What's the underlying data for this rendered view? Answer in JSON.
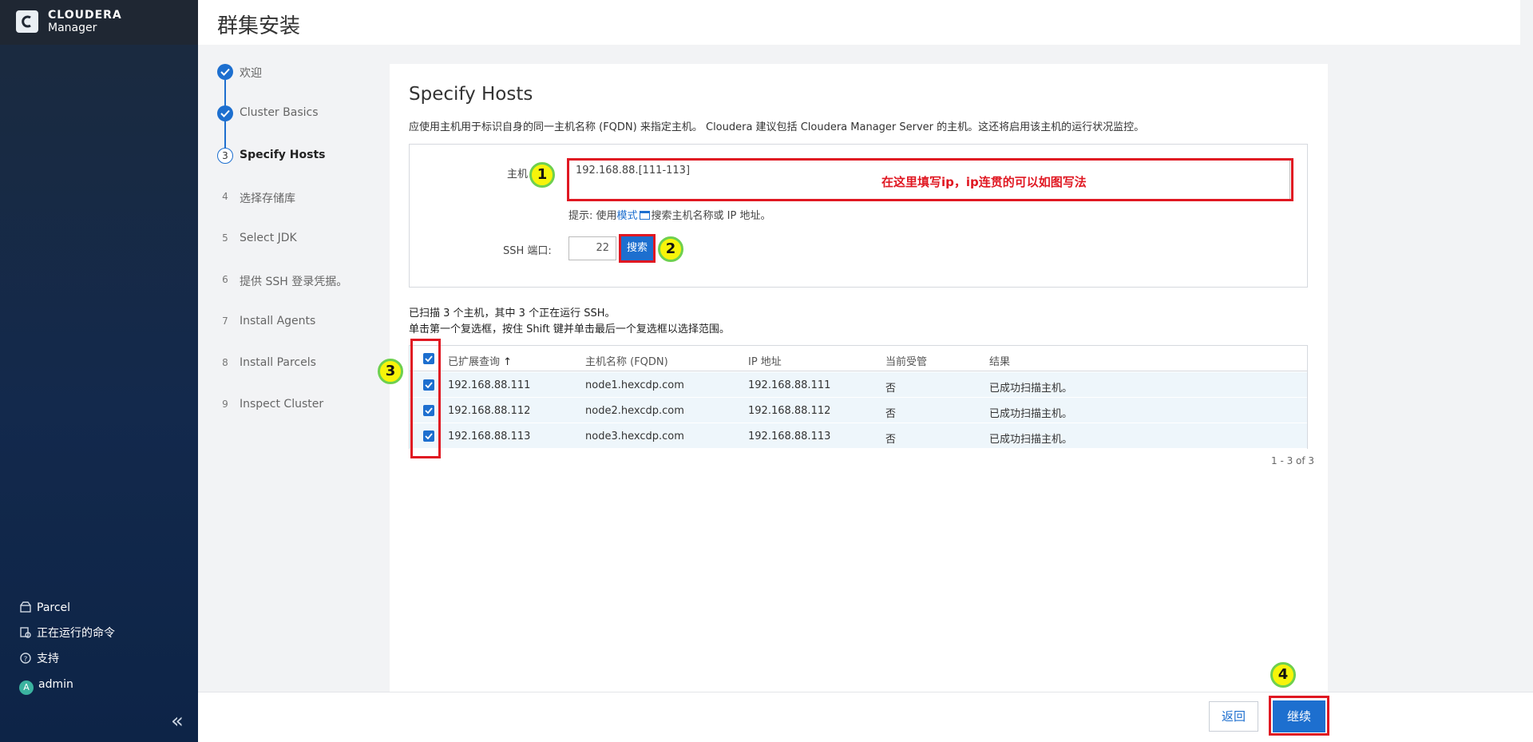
{
  "brand": {
    "line1": "CLOUDERA",
    "line2": "Manager"
  },
  "page_title": "群集安装",
  "steps": [
    {
      "num": "✓",
      "label": "欢迎",
      "state": "done"
    },
    {
      "num": "✓",
      "label": "Cluster Basics",
      "state": "done"
    },
    {
      "num": "3",
      "label": "Specify Hosts",
      "state": "current"
    },
    {
      "num": "4",
      "label": "选择存储库",
      "state": "todo"
    },
    {
      "num": "5",
      "label": "Select JDK",
      "state": "todo"
    },
    {
      "num": "6",
      "label": "提供 SSH 登录凭据。",
      "state": "todo"
    },
    {
      "num": "7",
      "label": "Install Agents",
      "state": "todo"
    },
    {
      "num": "8",
      "label": "Install Parcels",
      "state": "todo"
    },
    {
      "num": "9",
      "label": "Inspect Cluster",
      "state": "todo"
    }
  ],
  "sidebar_footer": [
    {
      "icon": "parcel-icon",
      "label": "Parcel"
    },
    {
      "icon": "commands-icon",
      "label": "正在运行的命令"
    },
    {
      "icon": "help-icon",
      "label": "支持"
    },
    {
      "icon": "avatar",
      "avatar_letter": "A",
      "label": "admin"
    }
  ],
  "collapse_label": "«",
  "main": {
    "title": "Specify Hosts",
    "description": "应使用主机用于标识自身的同一主机名称 (FQDN) 来指定主机。 Cloudera 建议包括 Cloudera Manager Server 的主机。这还将启用该主机的运行状况监控。",
    "hosts_label": "主机",
    "hosts_value": "192.168.88.[111-113]",
    "hint_prefix": "提示: 使用",
    "hint_link": "模式",
    "hint_suffix": "搜索主机名称或 IP 地址。",
    "ssh_label": "SSH 端口:",
    "ssh_port": "22",
    "search_button": "搜索",
    "scan_summary": "已扫描 3 个主机，其中 3 个正在运行 SSH。",
    "scan_hint": "单击第一个复选框，按住 Shift 键并单击最后一个复选框以选择范围。",
    "table": {
      "headers": [
        "已扩展查询",
        "主机名称 (FQDN)",
        "IP 地址",
        "当前受管",
        "结果"
      ],
      "sort_indicator": "↑",
      "rows": [
        {
          "query": "192.168.88.111",
          "fqdn": "node1.hexcdp.com",
          "ip": "192.168.88.111",
          "managed": "否",
          "result": "已成功扫描主机。",
          "checked": true
        },
        {
          "query": "192.168.88.112",
          "fqdn": "node2.hexcdp.com",
          "ip": "192.168.88.112",
          "managed": "否",
          "result": "已成功扫描主机。",
          "checked": true
        },
        {
          "query": "192.168.88.113",
          "fqdn": "node3.hexcdp.com",
          "ip": "192.168.88.113",
          "managed": "否",
          "result": "已成功扫描主机。",
          "checked": true
        }
      ]
    },
    "pager": "1 - 3 of 3"
  },
  "footer": {
    "back": "返回",
    "continue": "继续"
  },
  "annotations": {
    "marker1": "1",
    "marker2": "2",
    "marker3": "3",
    "marker4": "4",
    "note": "在这里填写ip，ip连贯的可以如图写法"
  },
  "colors": {
    "accent": "#1d6fcf",
    "annotation": "#e01822",
    "marker": "#f7f40a"
  }
}
